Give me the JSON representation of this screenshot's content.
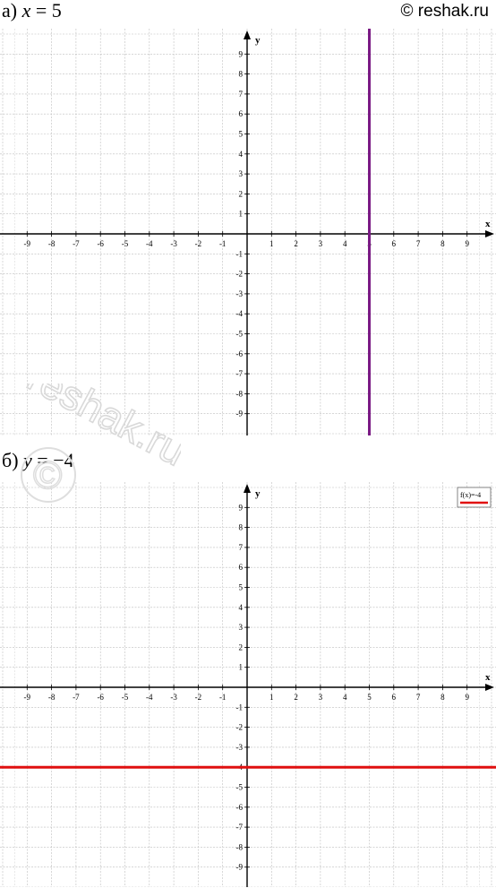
{
  "header": {
    "copyright": "© reshak.ru",
    "label_a": {
      "prefix": "а) ",
      "var": "x",
      "rest": " = 5"
    },
    "label_b": {
      "prefix": "б) ",
      "var": "y",
      "rest": " = −4"
    }
  },
  "watermark": {
    "text": "reshak.ru",
    "symbol": "©"
  },
  "chart_data": [
    {
      "type": "line",
      "title": "а) x = 5",
      "xlabel": "x",
      "ylabel": "y",
      "xlim": [
        -10,
        10
      ],
      "ylim": [
        -10,
        10
      ],
      "xticks": [
        -9,
        -8,
        -7,
        -6,
        -5,
        -4,
        -3,
        -2,
        -1,
        1,
        2,
        3,
        4,
        5,
        6,
        7,
        8,
        9
      ],
      "yticks": [
        -9,
        -8,
        -7,
        -6,
        -5,
        -4,
        -3,
        -2,
        -1,
        1,
        2,
        3,
        4,
        5,
        6,
        7,
        8,
        9
      ],
      "grid": true,
      "series": [
        {
          "kind": "vertical",
          "x": 5,
          "color": "#7a1a84"
        }
      ]
    },
    {
      "type": "line",
      "title": "б) y = −4",
      "xlabel": "x",
      "ylabel": "y",
      "xlim": [
        -10,
        10
      ],
      "ylim": [
        -10,
        10
      ],
      "xticks": [
        -9,
        -8,
        -7,
        -6,
        -5,
        -4,
        -3,
        -2,
        -1,
        1,
        2,
        3,
        4,
        5,
        6,
        7,
        8,
        9
      ],
      "yticks": [
        -9,
        -8,
        -7,
        -6,
        -5,
        -4,
        -3,
        -2,
        -1,
        1,
        2,
        3,
        4,
        5,
        6,
        7,
        8,
        9
      ],
      "grid": true,
      "legend": {
        "text": "f(x)=-4",
        "position": "top-right"
      },
      "series": [
        {
          "kind": "horizontal",
          "name": "f(x)=-4",
          "y": -4,
          "color": "#e01010"
        }
      ]
    }
  ]
}
